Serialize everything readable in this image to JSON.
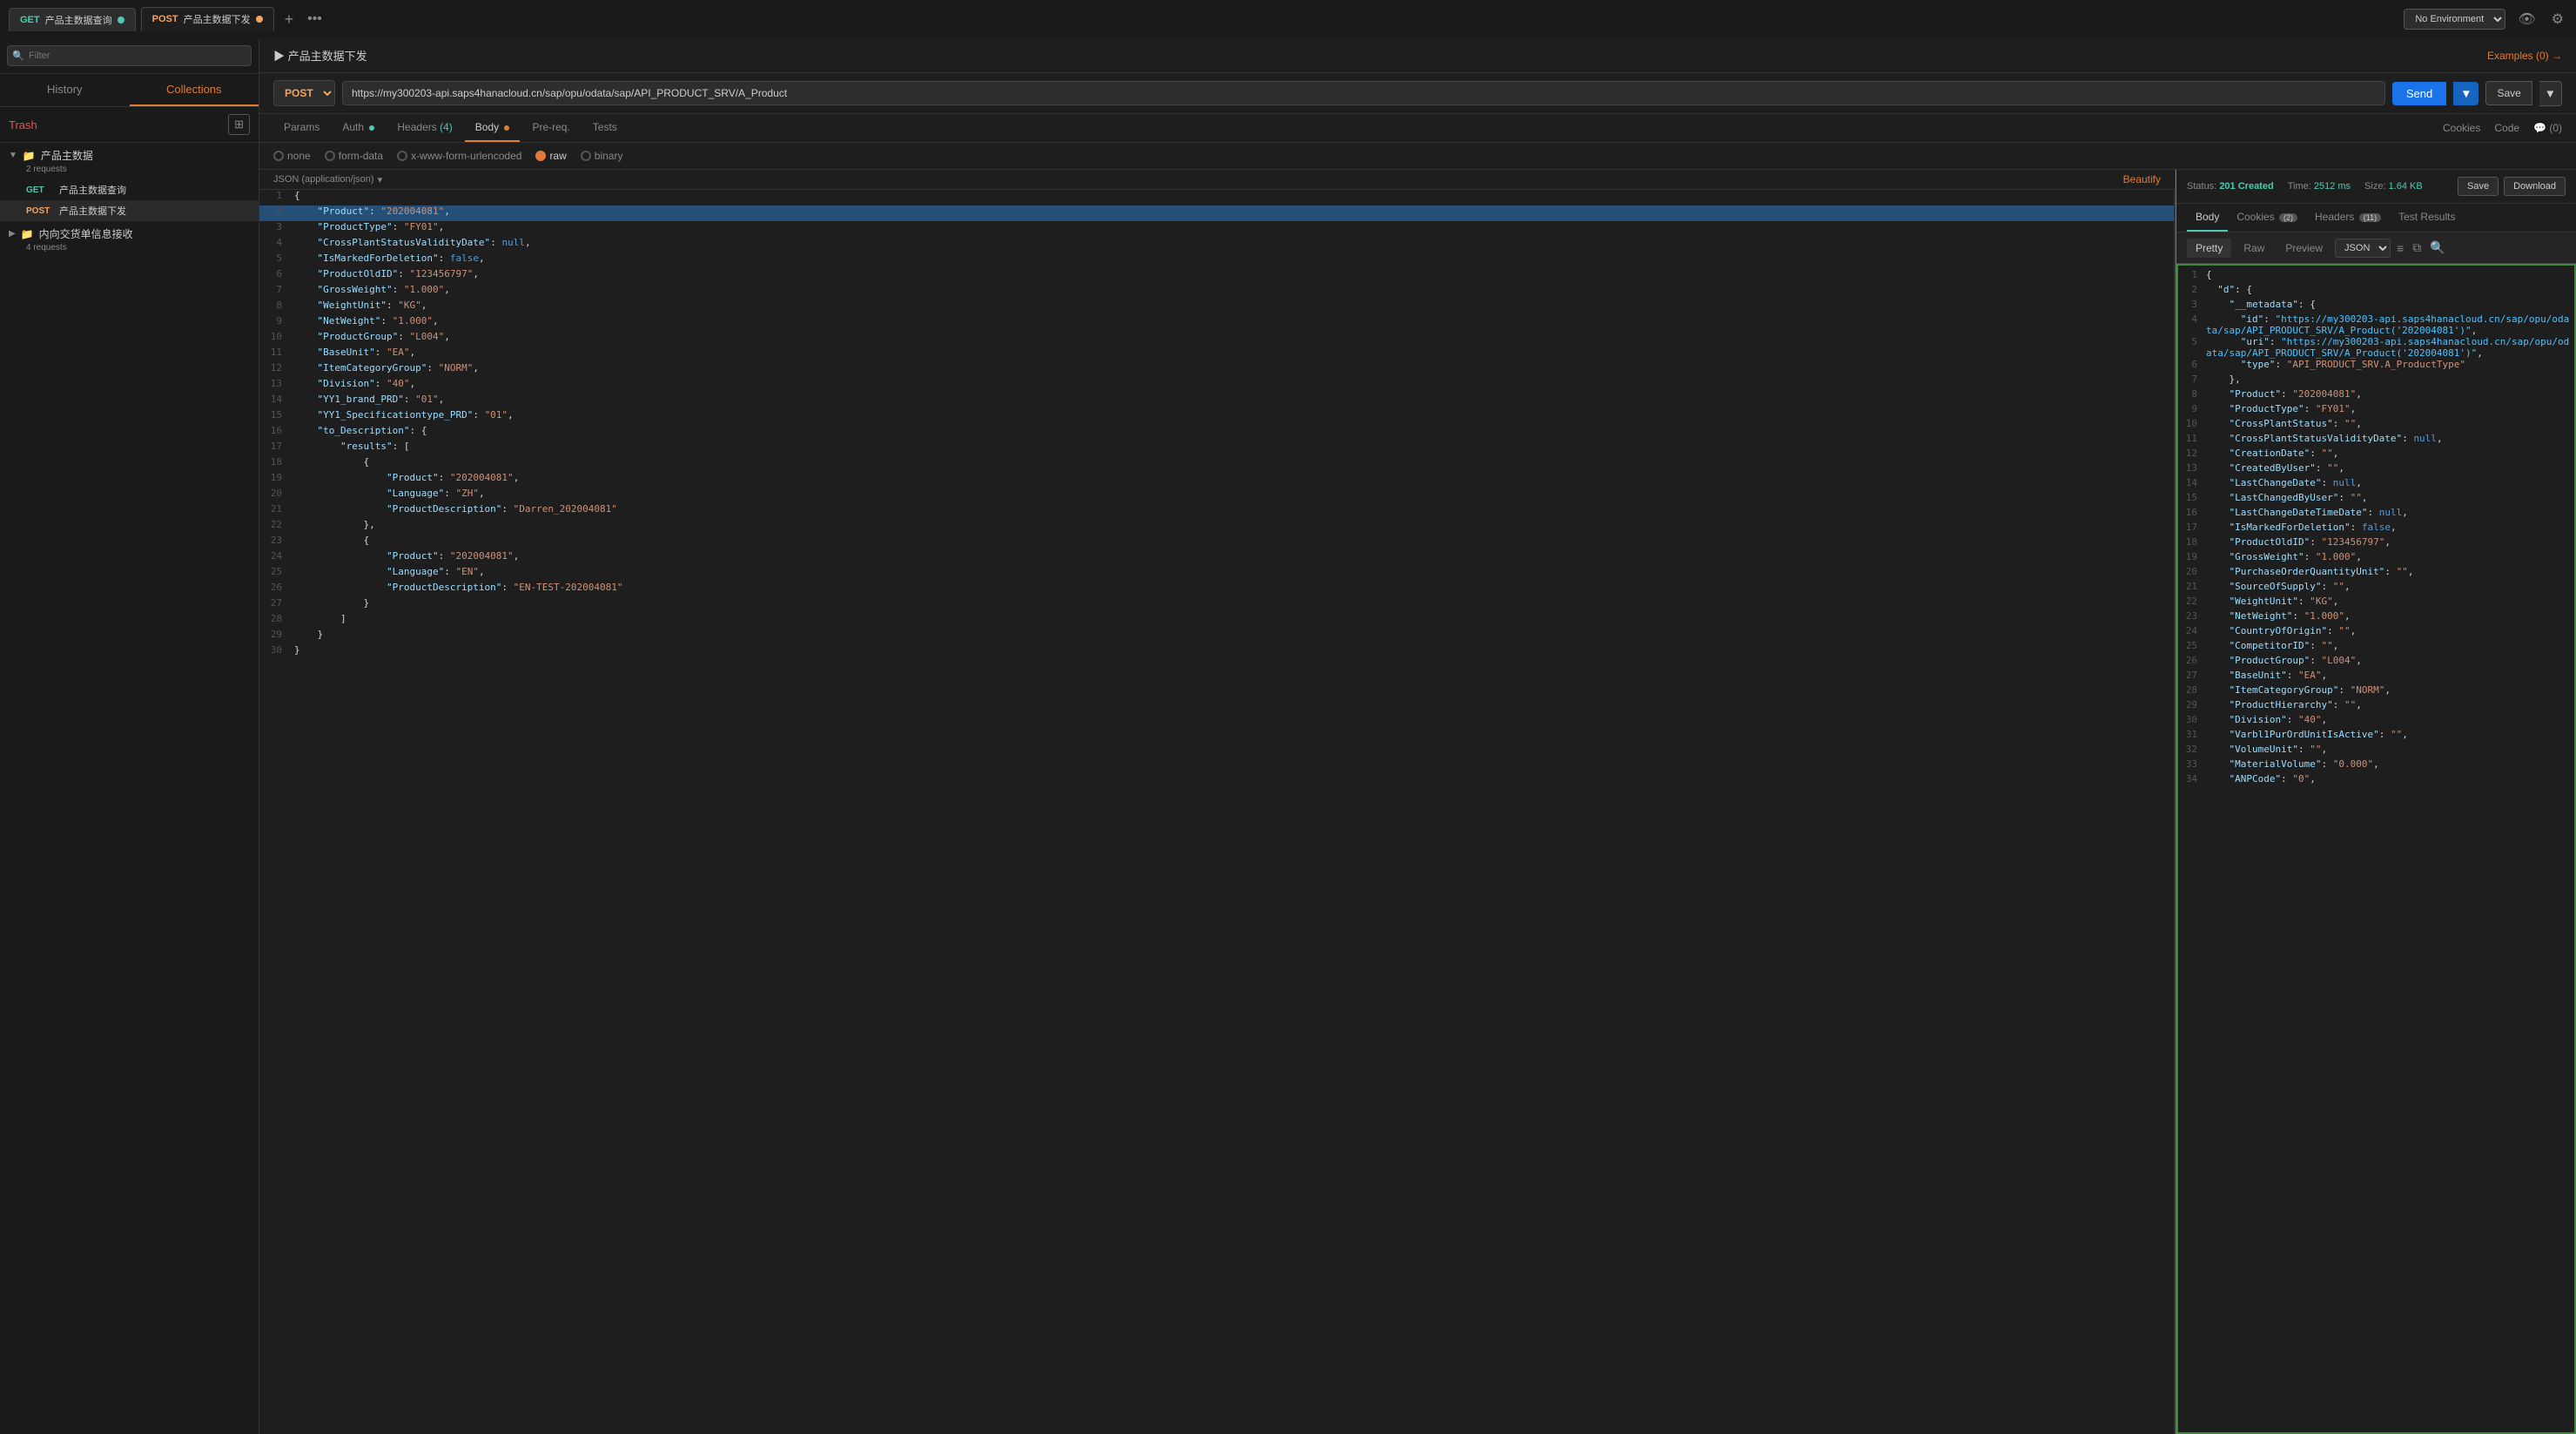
{
  "topbar": {
    "tabs": [
      {
        "id": "tab-get",
        "method": "GET",
        "name": "产品主数据查询",
        "type": "get",
        "active": false
      },
      {
        "id": "tab-post",
        "method": "POST",
        "name": "产品主数据下发",
        "type": "post",
        "active": true
      }
    ],
    "add_label": "+",
    "more_label": "•••",
    "env_label": "No Environment",
    "eye_icon": "👁",
    "gear_icon": "⚙"
  },
  "sidebar": {
    "search_placeholder": "Filter",
    "tab_history": "History",
    "tab_collections": "Collections",
    "trash_label": "Trash",
    "new_collection_icon": "⊞",
    "folders": [
      {
        "name": "产品主数据",
        "sub": "2 requests",
        "expanded": true,
        "requests": [
          {
            "method": "GET",
            "name": "产品主数据查询",
            "type": "get"
          },
          {
            "method": "POST",
            "name": "产品主数据下发",
            "type": "post",
            "active": true
          }
        ]
      },
      {
        "name": "内向交货单信息接收",
        "sub": "4 requests",
        "expanded": false,
        "requests": []
      }
    ]
  },
  "request": {
    "breadcrumb": "▶ 产品主数据下发",
    "examples_label": "Examples (0)  →",
    "method": "POST",
    "url": "https://my300203-api.saps4hanacloud.cn/sap/opu/odata/sap/API_PRODUCT_SRV/A_Product",
    "send_label": "Send",
    "save_label": "Save",
    "tabs": [
      {
        "label": "Params",
        "active": false,
        "badge": ""
      },
      {
        "label": "Auth",
        "active": false,
        "badge": "dot-green"
      },
      {
        "label": "Headers",
        "active": false,
        "badge": "(4)"
      },
      {
        "label": "Body",
        "active": true,
        "badge": "dot-orange"
      },
      {
        "label": "Pre-req.",
        "active": false,
        "badge": ""
      },
      {
        "label": "Tests",
        "active": false,
        "badge": ""
      }
    ],
    "beautify_label": "Beautify",
    "body_options": [
      {
        "label": "none",
        "active": false
      },
      {
        "label": "form-data",
        "active": false
      },
      {
        "label": "x-www-form-urlencoded",
        "active": false
      },
      {
        "label": "raw",
        "active": true
      },
      {
        "label": "binary",
        "active": false
      }
    ],
    "json_format": "JSON (application/json)",
    "code_lines": [
      {
        "num": 1,
        "content": "{",
        "highlight": false
      },
      {
        "num": 2,
        "content": "    \"Product\": \"202004081\",",
        "highlight": true
      },
      {
        "num": 3,
        "content": "    \"ProductType\": \"FY01\",",
        "highlight": false
      },
      {
        "num": 4,
        "content": "    \"CrossPlantStatusValidityDate\": null,",
        "highlight": false
      },
      {
        "num": 5,
        "content": "    \"IsMarkedForDeletion\": false,",
        "highlight": false
      },
      {
        "num": 6,
        "content": "    \"ProductOldID\": \"123456797\",",
        "highlight": false
      },
      {
        "num": 7,
        "content": "    \"GrossWeight\": \"1.000\",",
        "highlight": false
      },
      {
        "num": 8,
        "content": "    \"WeightUnit\": \"KG\",",
        "highlight": false
      },
      {
        "num": 9,
        "content": "    \"NetWeight\": \"1.000\",",
        "highlight": false
      },
      {
        "num": 10,
        "content": "    \"ProductGroup\": \"L004\",",
        "highlight": false
      },
      {
        "num": 11,
        "content": "    \"BaseUnit\": \"EA\",",
        "highlight": false
      },
      {
        "num": 12,
        "content": "    \"ItemCategoryGroup\": \"NORM\",",
        "highlight": false
      },
      {
        "num": 13,
        "content": "    \"Division\": \"40\",",
        "highlight": false
      },
      {
        "num": 14,
        "content": "    \"YY1_brand_PRD\": \"01\",",
        "highlight": false
      },
      {
        "num": 15,
        "content": "    \"YY1_Specificationtype_PRD\": \"01\",",
        "highlight": false
      },
      {
        "num": 16,
        "content": "    \"to_Description\": {",
        "highlight": false
      },
      {
        "num": 17,
        "content": "        \"results\": [",
        "highlight": false
      },
      {
        "num": 18,
        "content": "            {",
        "highlight": false
      },
      {
        "num": 19,
        "content": "                \"Product\": \"202004081\",",
        "highlight": false
      },
      {
        "num": 20,
        "content": "                \"Language\": \"ZH\",",
        "highlight": false
      },
      {
        "num": 21,
        "content": "                \"ProductDescription\": \"Darren_202004081\"",
        "highlight": false
      },
      {
        "num": 22,
        "content": "            },",
        "highlight": false
      },
      {
        "num": 23,
        "content": "            {",
        "highlight": false
      },
      {
        "num": 24,
        "content": "                \"Product\": \"202004081\",",
        "highlight": false
      },
      {
        "num": 25,
        "content": "                \"Language\": \"EN\",",
        "highlight": false
      },
      {
        "num": 26,
        "content": "                \"ProductDescription\": \"EN-TEST-202004081\"",
        "highlight": false
      },
      {
        "num": 27,
        "content": "            }",
        "highlight": false
      },
      {
        "num": 28,
        "content": "        ]",
        "highlight": false
      },
      {
        "num": 29,
        "content": "    }",
        "highlight": false
      },
      {
        "num": 30,
        "content": "}",
        "highlight": false
      }
    ]
  },
  "response": {
    "status_label": "Status:",
    "status_value": "201 Created",
    "time_label": "Time:",
    "time_value": "2512 ms",
    "size_label": "Size:",
    "size_value": "1.64 KB",
    "save_label": "Save",
    "download_label": "Download",
    "tabs": [
      {
        "label": "Body",
        "active": true,
        "badge": ""
      },
      {
        "label": "Cookies",
        "active": false,
        "badge": "(2)"
      },
      {
        "label": "Headers",
        "active": false,
        "badge": "(11)"
      },
      {
        "label": "Test Results",
        "active": false,
        "badge": ""
      }
    ],
    "view_tabs": [
      {
        "label": "Pretty",
        "active": true
      },
      {
        "label": "Raw",
        "active": false
      },
      {
        "label": "Preview",
        "active": false
      }
    ],
    "format": "JSON",
    "lines": [
      {
        "num": 1,
        "html": "<span class='punct'>{</span>"
      },
      {
        "num": 2,
        "html": "  <span class='key'>\"d\"</span><span class='punct'>: {</span>"
      },
      {
        "num": 3,
        "html": "    <span class='key'>\"__metadata\"</span><span class='punct'>: {</span>"
      },
      {
        "num": 4,
        "html": "      <span class='key'>\"id\"</span><span class='punct'>: </span><span class='url'>\"https://my300203-api.saps4hanacloud.cn/sap/opu/odata/sap/API_PRODUCT_SRV/A_Product('202004081')\"</span><span class='punct'>,</span>"
      },
      {
        "num": 5,
        "html": "      <span class='key'>\"uri\"</span><span class='punct'>: </span><span class='url'>\"https://my300203-api.saps4hanacloud.cn/sap/opu/odata/sap/API_PRODUCT_SRV/A_Product('202004081')\"</span><span class='punct'>,</span>"
      },
      {
        "num": 6,
        "html": "      <span class='key'>\"type\"</span><span class='punct'>: </span><span class='str'>\"API_PRODUCT_SRV.A_ProductType\"</span>"
      },
      {
        "num": 7,
        "html": "    <span class='punct'>},</span>"
      },
      {
        "num": 8,
        "html": "    <span class='key'>\"Product\"</span><span class='punct'>: </span><span class='str'>\"202004081\"</span><span class='punct'>,</span>"
      },
      {
        "num": 9,
        "html": "    <span class='key'>\"ProductType\"</span><span class='punct'>: </span><span class='str'>\"FY01\"</span><span class='punct'>,</span>"
      },
      {
        "num": 10,
        "html": "    <span class='key'>\"CrossPlantStatus\"</span><span class='punct'>: </span><span class='str'>\"\"</span><span class='punct'>,</span>"
      },
      {
        "num": 11,
        "html": "    <span class='key'>\"CrossPlantStatusValidityDate\"</span><span class='punct'>: </span><span class='null-val'>null</span><span class='punct'>,</span>"
      },
      {
        "num": 12,
        "html": "    <span class='key'>\"CreationDate\"</span><span class='punct'>: </span><span class='str'>\"\"</span><span class='punct'>,</span>"
      },
      {
        "num": 13,
        "html": "    <span class='key'>\"CreatedByUser\"</span><span class='punct'>: </span><span class='str'>\"\"</span><span class='punct'>,</span>"
      },
      {
        "num": 14,
        "html": "    <span class='key'>\"LastChangeDate\"</span><span class='punct'>: </span><span class='null-val'>null</span><span class='punct'>,</span>"
      },
      {
        "num": 15,
        "html": "    <span class='key'>\"LastChangedByUser\"</span><span class='punct'>: </span><span class='str'>\"\"</span><span class='punct'>,</span>"
      },
      {
        "num": 16,
        "html": "    <span class='key'>\"LastChangeDateTimeDate\"</span><span class='punct'>: </span><span class='null-val'>null</span><span class='punct'>,</span>"
      },
      {
        "num": 17,
        "html": "    <span class='key'>\"IsMarkedForDeletion\"</span><span class='punct'>: </span><span class='bool'>false</span><span class='punct'>,</span>"
      },
      {
        "num": 18,
        "html": "    <span class='key'>\"ProductOldID\"</span><span class='punct'>: </span><span class='str'>\"123456797\"</span><span class='punct'>,</span>"
      },
      {
        "num": 19,
        "html": "    <span class='key'>\"GrossWeight\"</span><span class='punct'>: </span><span class='str'>\"1.000\"</span><span class='punct'>,</span>"
      },
      {
        "num": 20,
        "html": "    <span class='key'>\"PurchaseOrderQuantityUnit\"</span><span class='punct'>: </span><span class='str'>\"\"</span><span class='punct'>,</span>"
      },
      {
        "num": 21,
        "html": "    <span class='key'>\"SourceOfSupply\"</span><span class='punct'>: </span><span class='str'>\"\"</span><span class='punct'>,</span>"
      },
      {
        "num": 22,
        "html": "    <span class='key'>\"WeightUnit\"</span><span class='punct'>: </span><span class='str'>\"KG\"</span><span class='punct'>,</span>"
      },
      {
        "num": 23,
        "html": "    <span class='key'>\"NetWeight\"</span><span class='punct'>: </span><span class='str'>\"1.000\"</span><span class='punct'>,</span>"
      },
      {
        "num": 24,
        "html": "    <span class='key'>\"CountryOfOrigin\"</span><span class='punct'>: </span><span class='str'>\"\"</span><span class='punct'>,</span>"
      },
      {
        "num": 25,
        "html": "    <span class='key'>\"CompetitorID\"</span><span class='punct'>: </span><span class='str'>\"\"</span><span class='punct'>,</span>"
      },
      {
        "num": 26,
        "html": "    <span class='key'>\"ProductGroup\"</span><span class='punct'>: </span><span class='str'>\"L004\"</span><span class='punct'>,</span>"
      },
      {
        "num": 27,
        "html": "    <span class='key'>\"BaseUnit\"</span><span class='punct'>: </span><span class='str'>\"EA\"</span><span class='punct'>,</span>"
      },
      {
        "num": 28,
        "html": "    <span class='key'>\"ItemCategoryGroup\"</span><span class='punct'>: </span><span class='str'>\"NORM\"</span><span class='punct'>,</span>"
      },
      {
        "num": 29,
        "html": "    <span class='key'>\"ProductHierarchy\"</span><span class='punct'>: </span><span class='str'>\"\"</span><span class='punct'>,</span>"
      },
      {
        "num": 30,
        "html": "    <span class='key'>\"Division\"</span><span class='punct'>: </span><span class='str'>\"40\"</span><span class='punct'>,</span>"
      },
      {
        "num": 31,
        "html": "    <span class='key'>\"Varbl1PurOrdUnitIsActive\"</span><span class='punct'>: </span><span class='str'>\"\"</span><span class='punct'>,</span>"
      },
      {
        "num": 32,
        "html": "    <span class='key'>\"VolumeUnit\"</span><span class='punct'>: </span><span class='str'>\"\"</span><span class='punct'>,</span>"
      },
      {
        "num": 33,
        "html": "    <span class='key'>\"MaterialVolume\"</span><span class='punct'>: </span><span class='str'>\"0.000\"</span><span class='punct'>,</span>"
      },
      {
        "num": 34,
        "html": "    <span class='key'>\"ANPCode\"</span><span class='punct'>: </span><span class='str'>\"0\"</span><span class='punct'>,</span>"
      }
    ]
  }
}
